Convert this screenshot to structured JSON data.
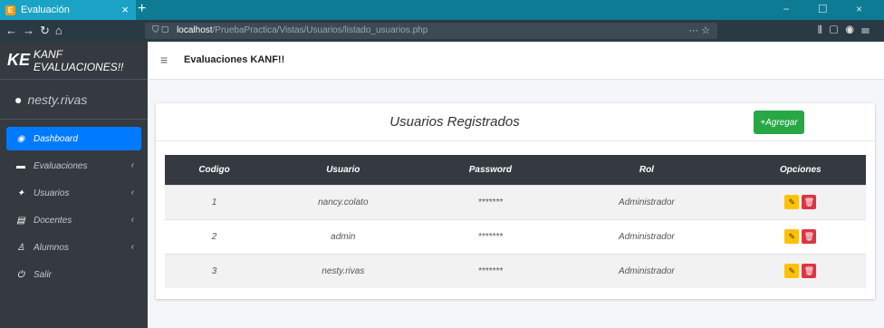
{
  "browser": {
    "tab_title": "Evaluación",
    "tab_close": "×",
    "new_tab": "+",
    "url_host": "localhost",
    "url_path": "/PruebaPractica/Vistas/Usuarios/listado_usuarios.php",
    "url_extra": "··· ☆",
    "window_controls": "− ☐ ×"
  },
  "sidebar": {
    "brand_ke": "KE",
    "brand_text": "KANF EVALUACIONES!!",
    "user": "nesty.rivas",
    "items": [
      {
        "label": "Dashboard",
        "icon": "dashboard-icon",
        "glyph": "◉"
      },
      {
        "label": "Evaluaciones",
        "icon": "folder-icon",
        "glyph": "▬"
      },
      {
        "label": "Usuarios",
        "icon": "users-icon",
        "glyph": "✦"
      },
      {
        "label": "Docentes",
        "icon": "building-icon",
        "glyph": "▤"
      },
      {
        "label": "Alumnos",
        "icon": "student-icon",
        "glyph": "♙"
      },
      {
        "label": "Salir",
        "icon": "power-icon",
        "glyph": "⏻"
      }
    ],
    "chevron": "‹"
  },
  "topbar": {
    "title": "Evaluaciones KANF!!"
  },
  "card": {
    "title": "Usuarios Registrados",
    "add_label": "Agregar",
    "add_icon": "+"
  },
  "table": {
    "headers": [
      "Codigo",
      "Usuario",
      "Password",
      "Rol",
      "Opciones"
    ],
    "rows": [
      {
        "codigo": "1",
        "usuario": "nancy.colato",
        "password": "*******",
        "rol": "Administrador"
      },
      {
        "codigo": "2",
        "usuario": "admin",
        "password": "*******",
        "rol": "Administrador"
      },
      {
        "codigo": "3",
        "usuario": "nesty.rivas",
        "password": "*******",
        "rol": "Administrador"
      }
    ]
  },
  "colors": {
    "sidebar": "#343a40",
    "active": "#007bff",
    "add": "#28a745",
    "edit": "#ffc107",
    "delete": "#dc3545"
  }
}
